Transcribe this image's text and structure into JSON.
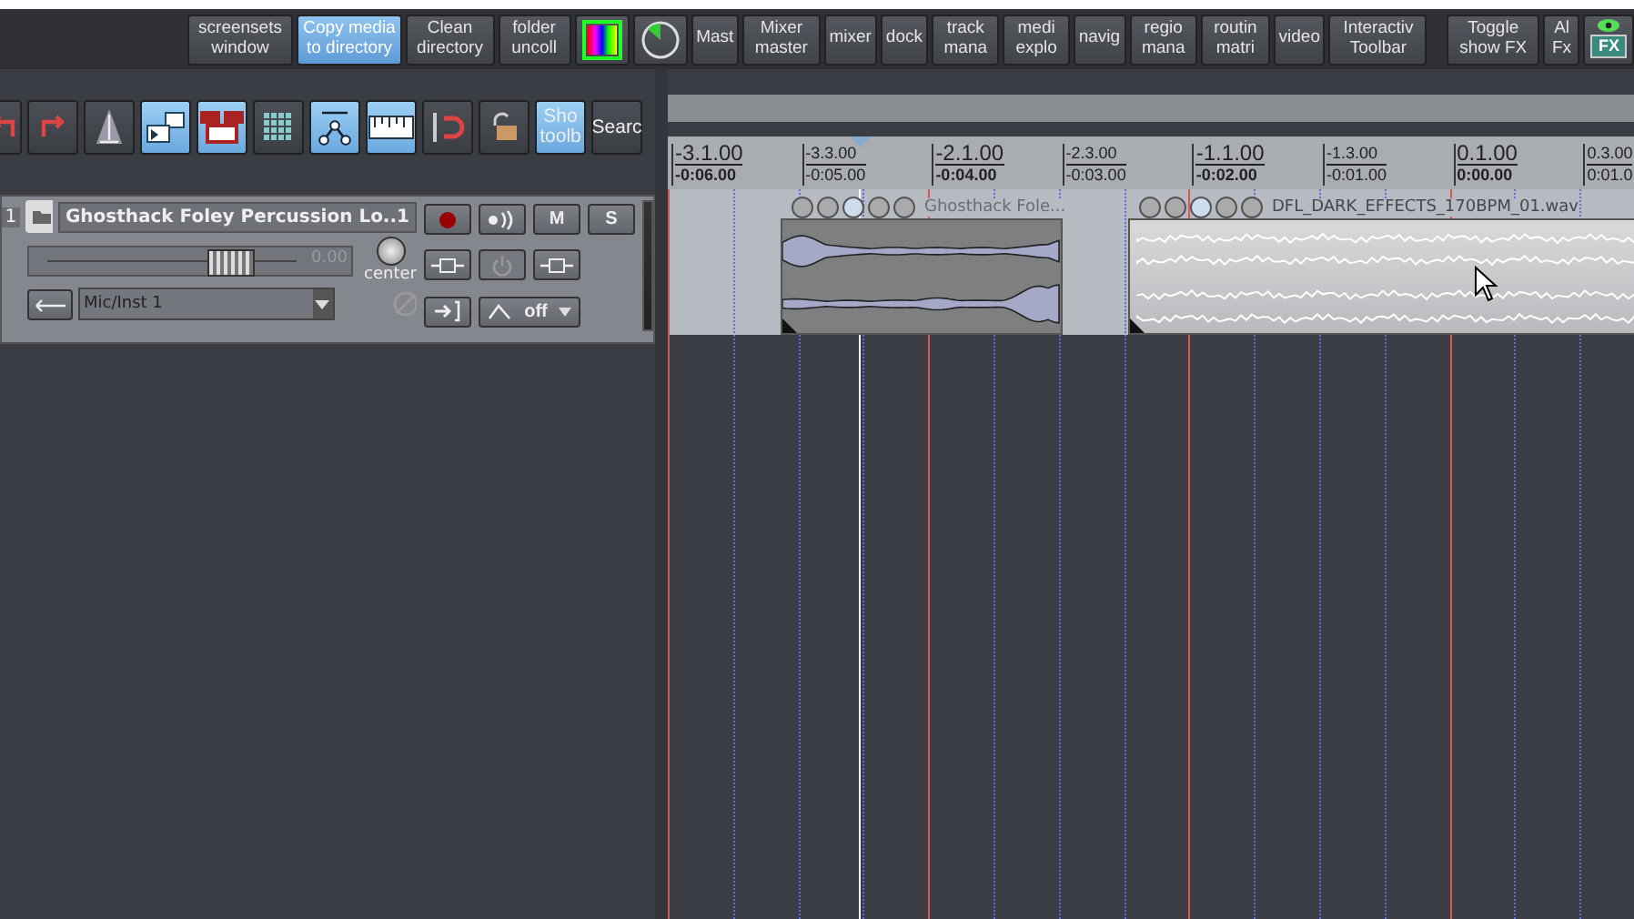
{
  "toolbar": [
    {
      "label": "screensets window",
      "selected": false
    },
    {
      "label": "Copy media to directory",
      "selected": true
    },
    {
      "label": "Clean directory",
      "selected": false
    },
    {
      "label": "folder uncoll",
      "selected": false
    },
    {
      "kind": "color-icon",
      "selected": false
    },
    {
      "kind": "clock-icon",
      "selected": false
    },
    {
      "label": "Mast",
      "selected": false
    },
    {
      "label": "Mixer master",
      "selected": false
    },
    {
      "label": "mixer",
      "selected": false
    },
    {
      "label": "dock",
      "selected": false
    },
    {
      "label": "track mana",
      "selected": false
    },
    {
      "label": "medi explo",
      "selected": false
    },
    {
      "label": "navig",
      "selected": false
    },
    {
      "label": "regio mana",
      "selected": false
    },
    {
      "label": "routin matri",
      "selected": false
    },
    {
      "label": "video",
      "selected": false
    },
    {
      "label": "Interactiv Toolbar",
      "selected": false
    }
  ],
  "toolbar_right": [
    {
      "label": "Toggle show FX",
      "selected": false
    },
    {
      "label": "Al Fx",
      "selected": false
    }
  ],
  "fx_toggle": {
    "label": "FX",
    "on": true
  },
  "arrange_toolbar": [
    {
      "selected": false
    },
    {
      "selected": false
    },
    {
      "selected": false
    },
    {
      "selected": true
    },
    {
      "selected": true
    },
    {
      "selected": false
    },
    {
      "selected": true
    },
    {
      "selected": true
    },
    {
      "selected": false
    },
    {
      "selected": false
    },
    {
      "label": "Sho toolb",
      "selected": true
    },
    {
      "label": "Searc",
      "selected": false
    }
  ],
  "track": {
    "number": "1",
    "name": "Ghosthack Foley Percussion Lo..1",
    "volume": "0.00",
    "level": 0.62,
    "pan": "center",
    "input": "Mic/Inst 1",
    "record_armed": true,
    "mute": "M",
    "solo": "S",
    "automation": "off"
  },
  "ruler": [
    {
      "beat": "-3.1.00",
      "time": "-0:06.00",
      "major": true
    },
    {
      "beat": "-3.3.00",
      "time": "-0:05.00",
      "major": false
    },
    {
      "beat": "-2.1.00",
      "time": "-0:04.00",
      "major": true
    },
    {
      "beat": "-2.3.00",
      "time": "-0:03.00",
      "major": false
    },
    {
      "beat": "-1.1.00",
      "time": "-0:02.00",
      "major": true
    },
    {
      "beat": "-1.3.00",
      "time": "-0:01.00",
      "major": false
    },
    {
      "beat": "0.1.00",
      "time": "0:00.00",
      "major": true
    },
    {
      "beat": "0.3.00",
      "time": "0:01.0",
      "major": false
    }
  ],
  "regions": [
    {
      "name": "Ghosthack Fole...",
      "selected": false
    },
    {
      "name": "DFL_DARK_EFFECTS_170BPM_01.wav",
      "selected": true
    }
  ]
}
